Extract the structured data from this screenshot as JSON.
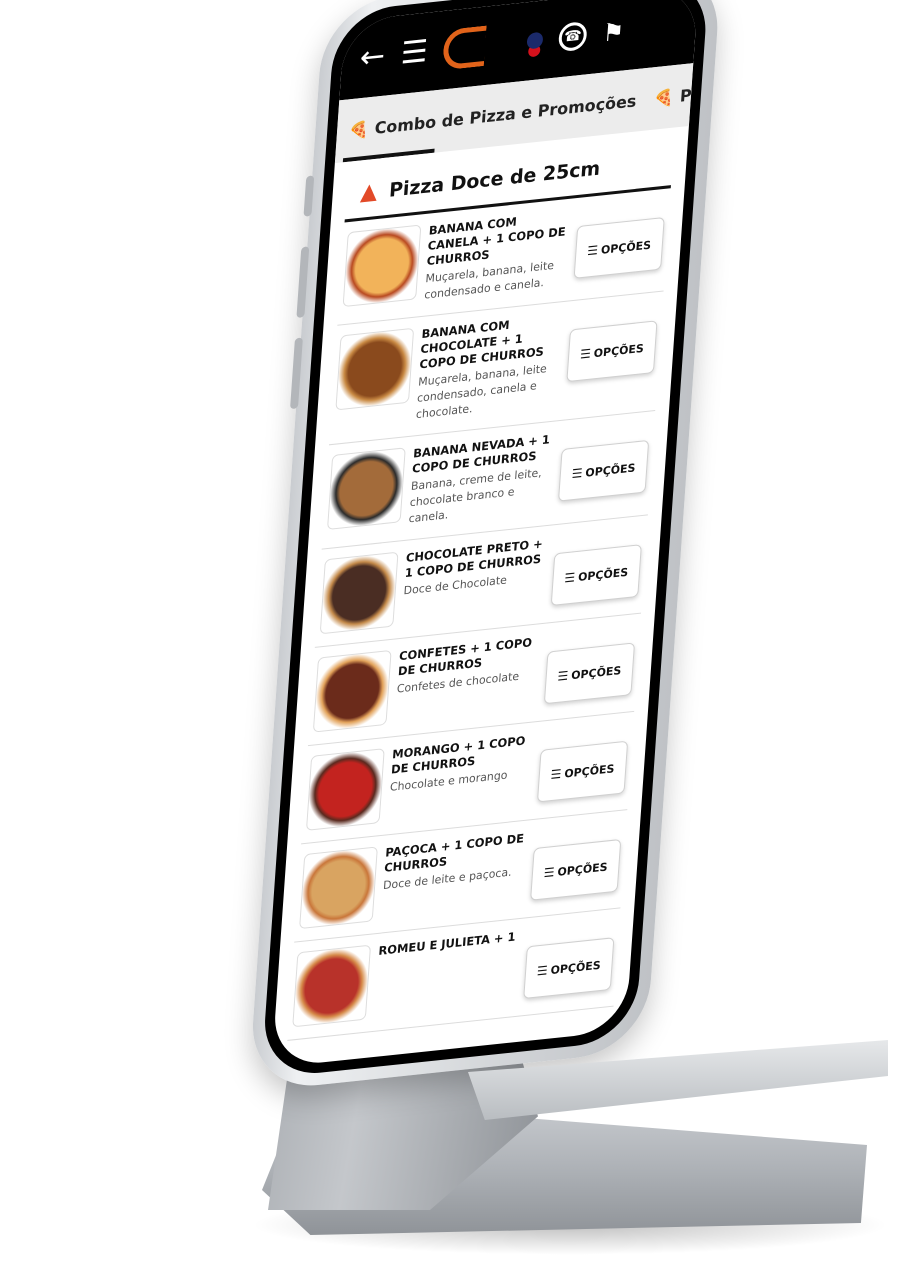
{
  "tabs": [
    {
      "emoji": "🍕",
      "label": "Combo de Pizza e Promoções"
    },
    {
      "emoji": "🍕",
      "label": "Pizza"
    }
  ],
  "section": {
    "title": "Pizza Doce de 25cm"
  },
  "options_label": "OPÇÕES",
  "items": [
    {
      "name": "BANANA COM CANELA + 1 COPO DE CHURROS",
      "desc": "Muçarela, banana, leite condensado e canela.",
      "colors": [
        "#f2b35a",
        "#b94a21"
      ]
    },
    {
      "name": "BANANA COM CHOCOLATE + 1 COPO DE CHURROS",
      "desc": "Muçarela, banana, leite condensado, canela e chocolate.",
      "colors": [
        "#8a4a1d",
        "#c98a44"
      ]
    },
    {
      "name": "BANANA NEVADA + 1 COPO DE CHURROS",
      "desc": "Banana, creme de leite, chocolate branco e canela.",
      "colors": [
        "#a36b3a",
        "#2b2b2b"
      ]
    },
    {
      "name": "CHOCOLATE PRETO + 1 COPO DE CHURROS",
      "desc": "Doce de Chocolate",
      "colors": [
        "#4a2d23",
        "#c48a4a"
      ]
    },
    {
      "name": "CONFETES + 1 COPO DE CHURROS",
      "desc": "Confetes de chocolate",
      "colors": [
        "#6b2b1b",
        "#e2a25a"
      ]
    },
    {
      "name": "MORANGO + 1 COPO DE CHURROS",
      "desc": "Chocolate e morango",
      "colors": [
        "#c3231f",
        "#5a2a1f"
      ]
    },
    {
      "name": "PAÇOCA + 1 COPO DE CHURROS",
      "desc": "Doce de leite e paçoca.",
      "colors": [
        "#d9a461",
        "#c9763a"
      ]
    },
    {
      "name": "ROMEU E JULIETA + 1",
      "desc": "",
      "colors": [
        "#b8322a",
        "#d68b4a"
      ]
    }
  ]
}
